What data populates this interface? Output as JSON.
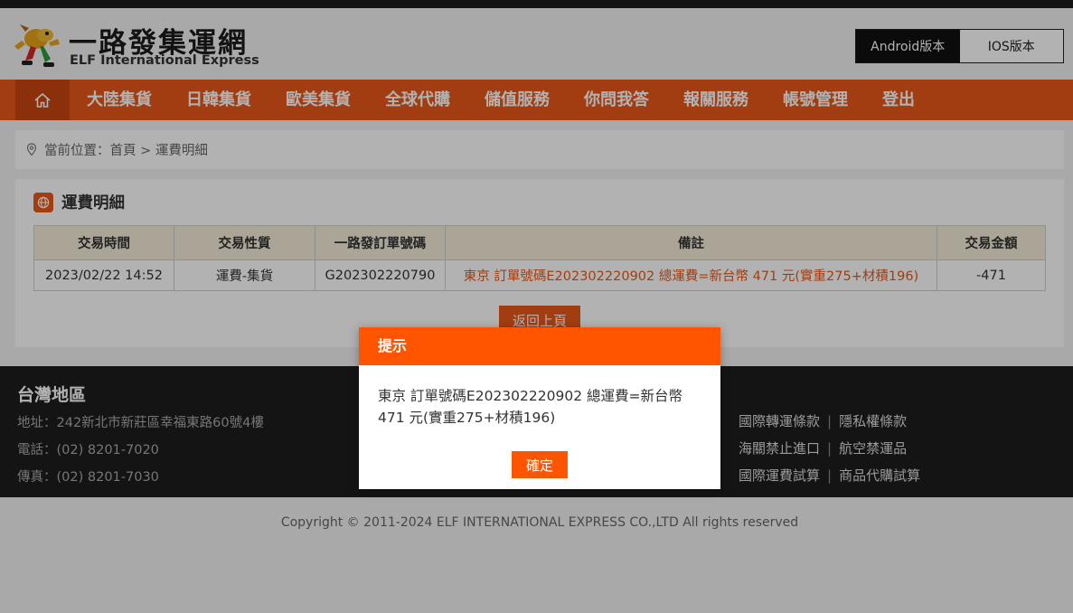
{
  "header": {
    "logo_cn": "一路發集運網",
    "logo_en": "ELF International Express",
    "android_label": "Android版本",
    "ios_label": "IOS版本"
  },
  "nav": {
    "items": [
      "大陸集貨",
      "日韓集貨",
      "歐美集貨",
      "全球代購",
      "儲值服務",
      "你問我答",
      "報關服務",
      "帳號管理",
      "登出"
    ]
  },
  "breadcrumb": {
    "text": "當前位置：首頁 > 運費明細"
  },
  "panel": {
    "title": "運費明細",
    "columns": [
      "交易時間",
      "交易性質",
      "一路發訂單號碼",
      "備註",
      "交易金額"
    ],
    "rows": [
      {
        "time": "2023/02/22 14:52",
        "type": "運費-集貨",
        "order_no": "G202302220790",
        "remark": "東京 訂單號碼E202302220902 總運費=新台幣 471 元(實重275+材積196)",
        "amount": "-471"
      }
    ],
    "back_label": "返回上頁"
  },
  "footer": {
    "region": "台灣地區",
    "address": "地址：242新北市新莊區幸福東路60號4樓",
    "phone": "電話：(02) 8201-7020",
    "fax": "傳真：(02) 8201-7030",
    "links": [
      [
        "國際轉運條款",
        "隱私權條款"
      ],
      [
        "海關禁止進口",
        "航空禁運品"
      ],
      [
        "國際運費試算",
        "商品代購試算"
      ]
    ],
    "copyright": "Copyright © 2011-2024 ELF INTERNATIONAL EXPRESS CO.,LTD All rights reserved"
  },
  "modal": {
    "title": "提示",
    "message": "東京 訂單號碼E202302220902 總運費=新台幣 471 元(實重275+材積196)",
    "ok_label": "確定"
  },
  "colors": {
    "brand_orange": "#e8581a",
    "modal_orange": "#ff5500",
    "footer_bg": "#1e1e1e"
  },
  "icons": {
    "home": "home-icon",
    "breadcrumb": "location-pin-icon",
    "panel": "globe-icon"
  }
}
